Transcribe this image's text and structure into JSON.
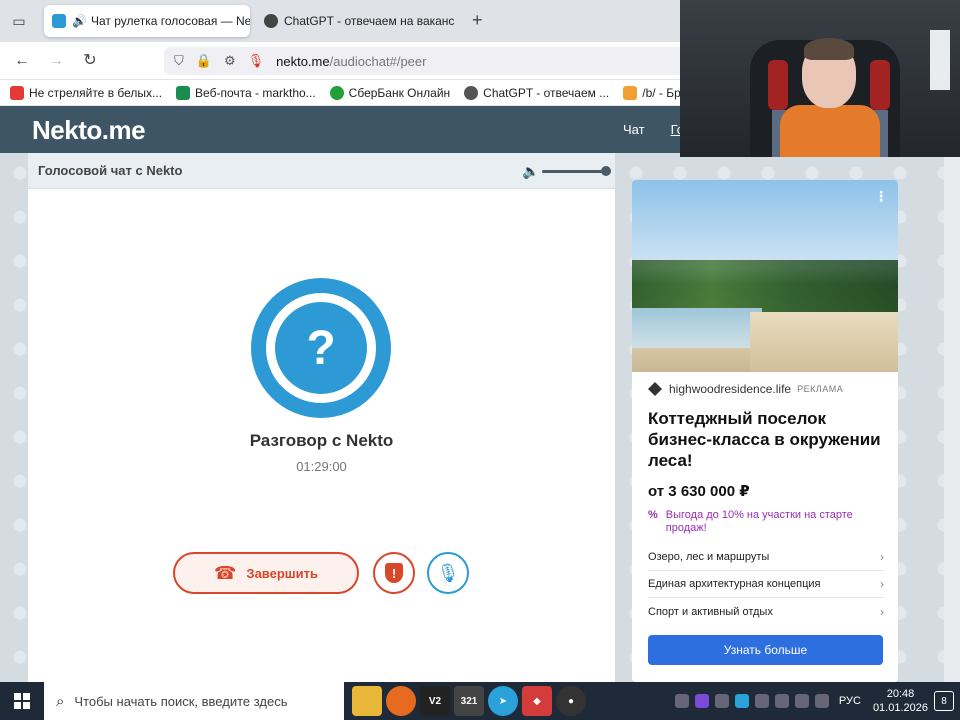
{
  "browser": {
    "tabs": [
      {
        "title": "Чат рулетка голосовая — Ne",
        "active": true
      },
      {
        "title": "ChatGPT - отвечаем на ваканс",
        "active": false
      }
    ],
    "url_host": "nekto.me",
    "url_path": "/audiochat#/peer",
    "bookmarks": [
      {
        "label": "Не стреляйте в белых...",
        "color": "#e53935"
      },
      {
        "label": "Веб-почта - marktho...",
        "color": "#1a8c4e"
      },
      {
        "label": "СберБанк Онлайн",
        "color": "#21a038"
      },
      {
        "label": "ChatGPT - отвечаем ...",
        "color": "#555555"
      },
      {
        "label": "/b/ - Бред",
        "color": "#f0a030"
      }
    ]
  },
  "site": {
    "logo": "Nekto.me",
    "nav": [
      "Чат",
      "Го"
    ]
  },
  "chat": {
    "header_title": "Голосовой чат с Nekto",
    "volume_level": 1.0,
    "avatar_symbol": "?",
    "peer_title": "Разговор с Nekto",
    "elapsed": "01:29:00",
    "end_label": "Завершить"
  },
  "ad": {
    "source": "highwoodresidence.life",
    "tag": "РЕКЛАМА",
    "title": "Коттеджный поселок бизнес-класса в окружении леса!",
    "price": "от 3 630 000 ₽",
    "promo": "Выгода до 10% на участки на старте продаж!",
    "links": [
      "Озеро, лес и маршруты",
      "Единая архитектурная концепция",
      "Спорт и активный отдых"
    ],
    "cta": "Узнать больше"
  },
  "taskbar": {
    "search_placeholder": "Чтобы начать поиск, введите здесь",
    "lang": "РУС",
    "time": "20:48",
    "date": "01.01.2026",
    "notifications": "8"
  },
  "colors": {
    "accent_blue": "#2d9ad6",
    "end_red": "#d9472b",
    "header_bg": "#3d5565",
    "promo_purple": "#9b2db5",
    "cta_blue": "#2e6fe0"
  }
}
